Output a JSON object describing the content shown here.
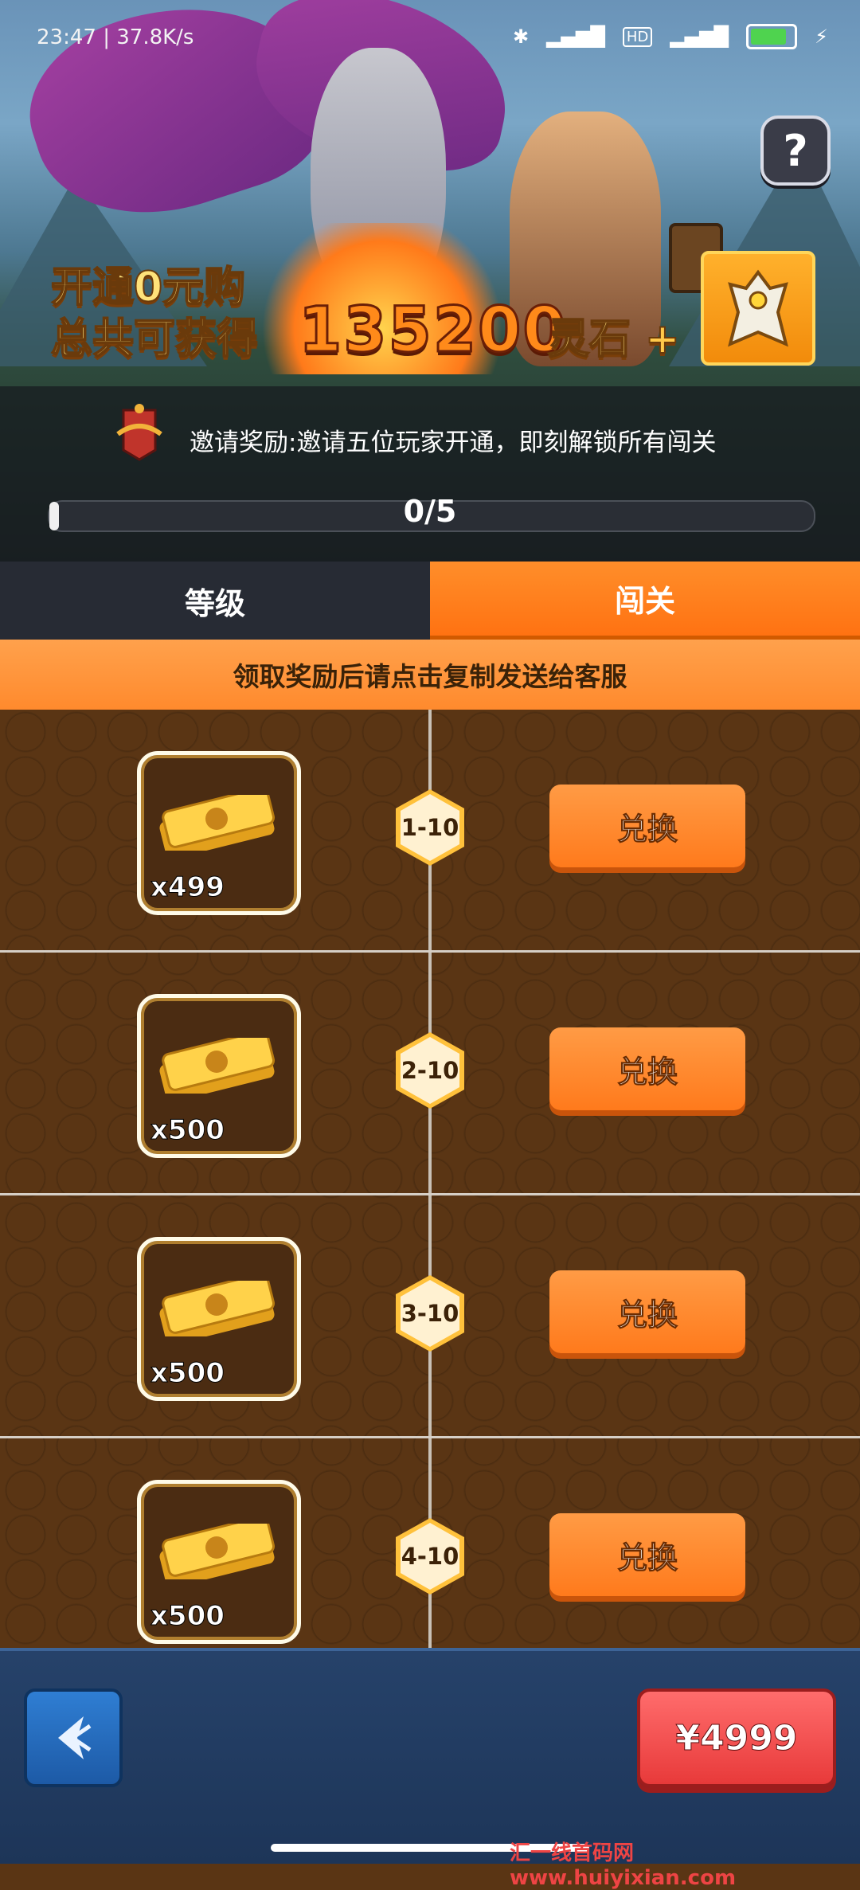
{
  "status_bar": {
    "time": "23:47",
    "speed": "37.8K/s",
    "network": "4G",
    "hd": "HD",
    "battery": "63"
  },
  "banner": {
    "help_icon": "question-icon",
    "promo_line1": "开通0元购",
    "promo_line2_prefix": "总共可获得",
    "amount": "135200",
    "currency": "灵石",
    "plus": "+"
  },
  "invite": {
    "text": "邀请奖励:邀请五位玩家开通，即刻解锁所有闯关",
    "progress_current": 0,
    "progress_total": 5,
    "progress_label": "0/5"
  },
  "tabs": [
    {
      "label": "等级",
      "active": false
    },
    {
      "label": "闯关",
      "active": true
    }
  ],
  "notice": "领取奖励后请点击复制发送给客服",
  "rewards": [
    {
      "qty": "x499",
      "stage": "1-10",
      "button": "兑换"
    },
    {
      "qty": "x500",
      "stage": "2-10",
      "button": "兑换"
    },
    {
      "qty": "x500",
      "stage": "3-10",
      "button": "兑换"
    },
    {
      "qty": "x500",
      "stage": "4-10",
      "button": "兑换"
    }
  ],
  "footer": {
    "price": "¥4999",
    "watermark": "汇一线首码网  www.huiyixian.com"
  },
  "colors": {
    "accent": "#ff7a1c",
    "tab_dark": "#272b34",
    "price_red": "#e83a3a",
    "bottom_blue": "#1d3558"
  }
}
